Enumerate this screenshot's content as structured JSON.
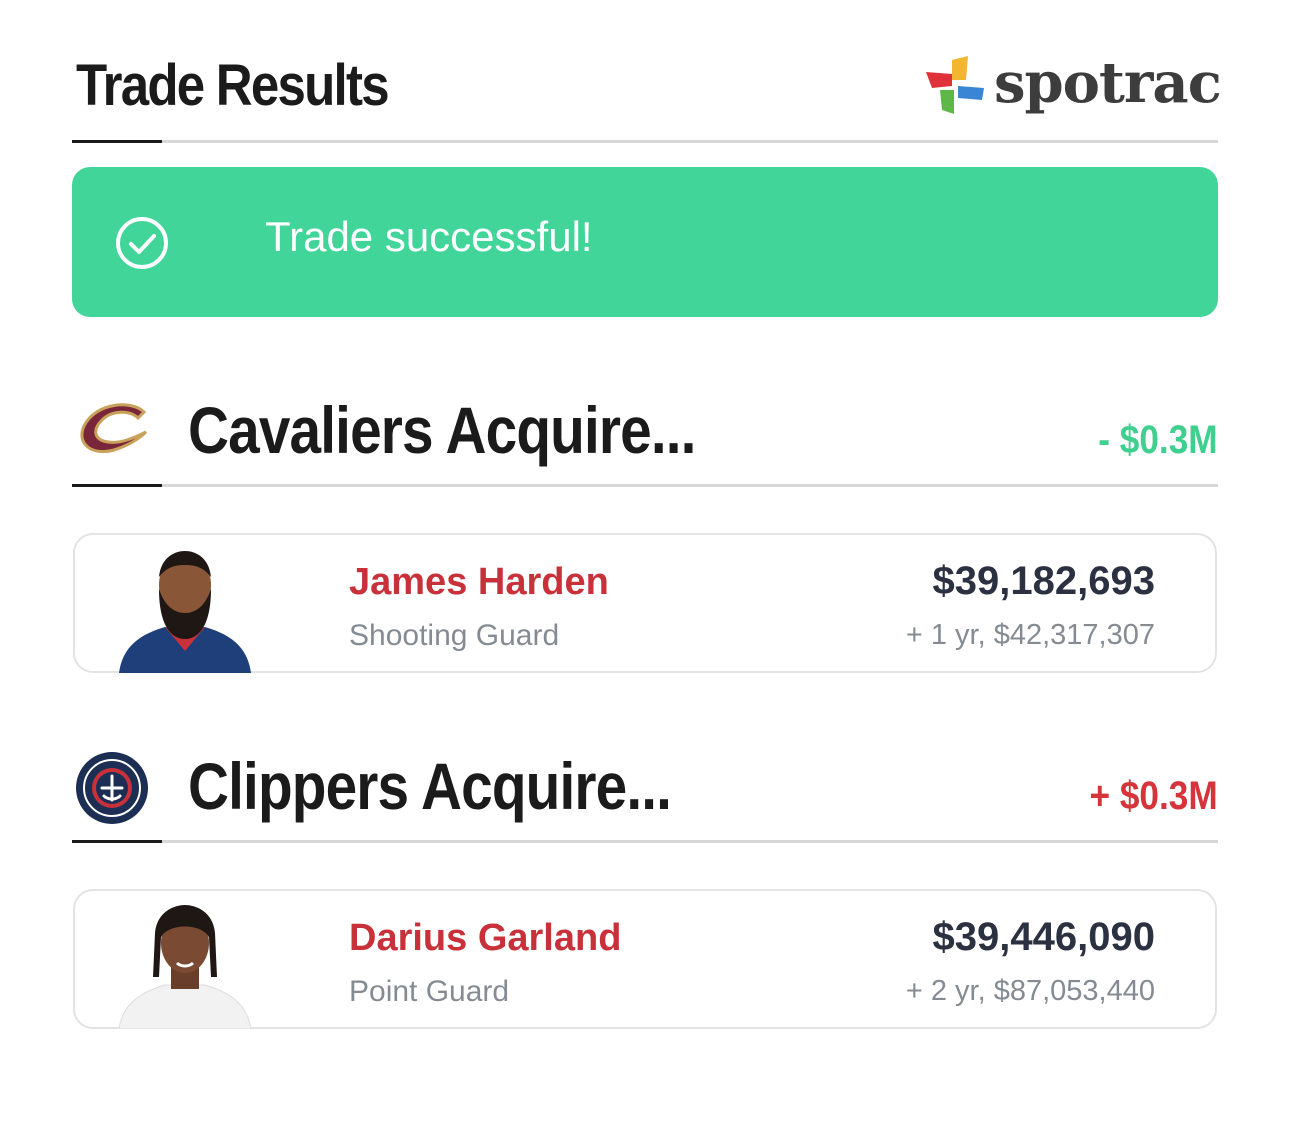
{
  "header": {
    "title": "Trade Results",
    "brand": "spotrac"
  },
  "alert": {
    "message": "Trade successful!",
    "icon": "check-circle-icon"
  },
  "colors": {
    "success": "#42d599",
    "negative": "#3fcf8f",
    "positive": "#d4343a",
    "player_name": "#c8313a"
  },
  "sections": [
    {
      "title": "Cavaliers Acquire...",
      "team_icon": "cavaliers-logo",
      "cap_change": "- $0.3M",
      "players": [
        {
          "name": "James Harden",
          "position": "Shooting Guard",
          "salary": "$39,182,693",
          "contract": "+ 1 yr, $42,317,307"
        }
      ]
    },
    {
      "title": "Clippers Acquire...",
      "team_icon": "clippers-logo",
      "cap_change": "+ $0.3M",
      "players": [
        {
          "name": "Darius Garland",
          "position": "Point Guard",
          "salary": "$39,446,090",
          "contract": "+ 2 yr, $87,053,440"
        }
      ]
    }
  ]
}
